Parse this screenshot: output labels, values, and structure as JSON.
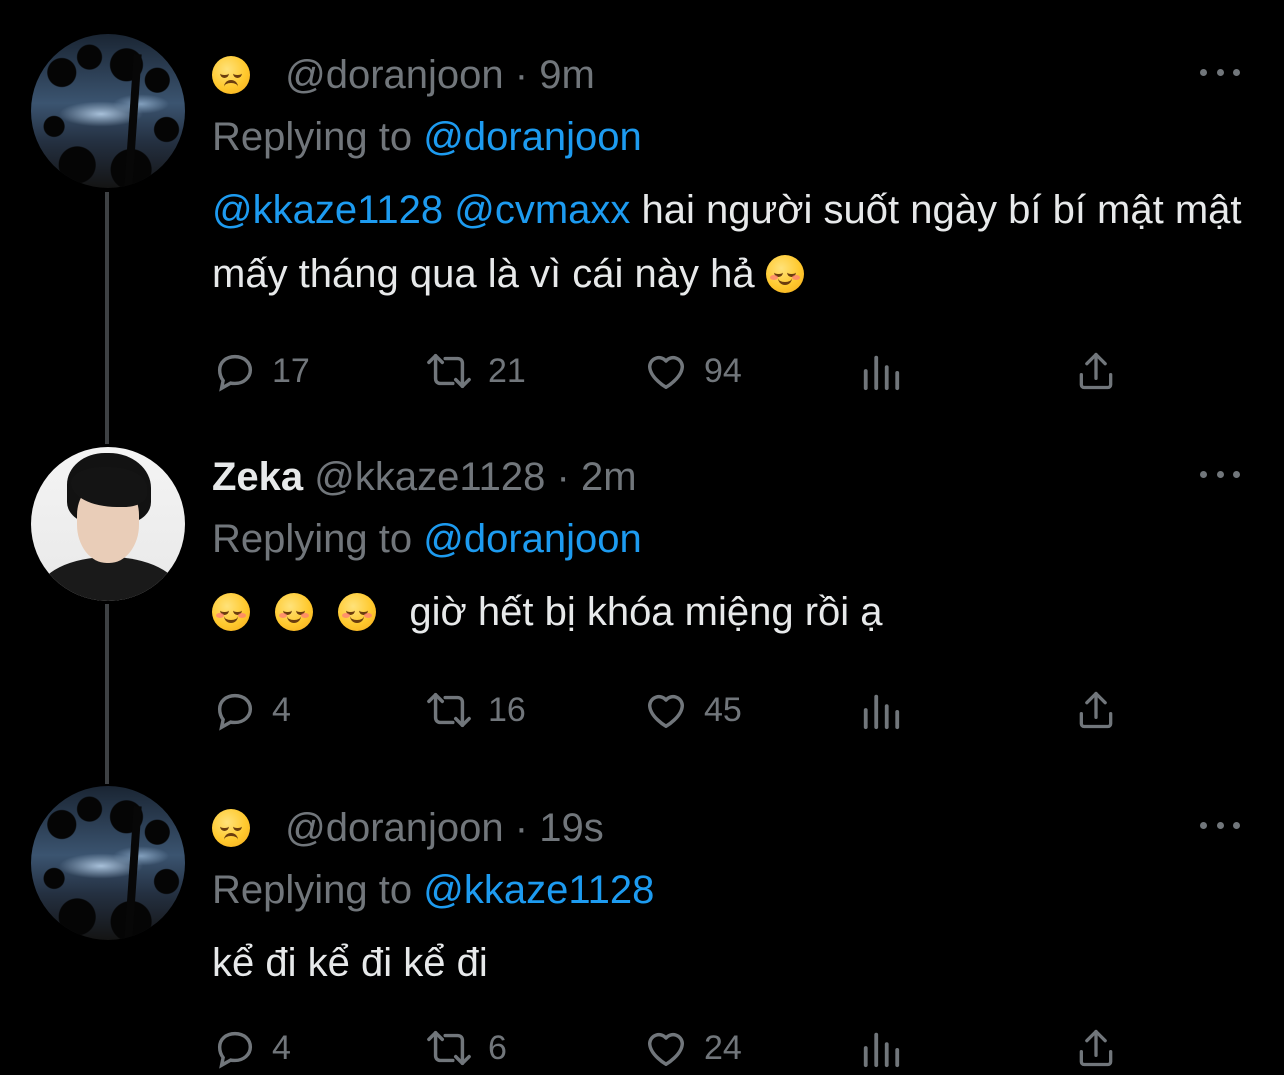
{
  "tweets": [
    {
      "display_name": "",
      "name_emoji": "pensive-face",
      "handle": "@doranjoon",
      "separator": "·",
      "time": "9m",
      "replying_prefix": "Replying to",
      "replying_to": "@doranjoon",
      "text_mention_1": "@kkaze1128",
      "text_mention_2": "@cvmaxx",
      "text": "hai người suốt ngày bí bí mật mật mấy tháng qua là vì cái này hả",
      "text_emoji": "smiling-face",
      "replies": "17",
      "retweets": "21",
      "likes": "94"
    },
    {
      "display_name": "Zeka",
      "handle": "@kkaze1128",
      "separator": "·",
      "time": "2m",
      "replying_prefix": "Replying to",
      "replying_to": "@doranjoon",
      "text_emojis": [
        "smiling-face-with-smiling-eyes",
        "smiling-face-with-smiling-eyes",
        "smiling-face-with-smiling-eyes"
      ],
      "text": "giờ hết bị khóa miệng rồi ạ",
      "replies": "4",
      "retweets": "16",
      "likes": "45"
    },
    {
      "display_name": "",
      "name_emoji": "pensive-face",
      "handle": "@doranjoon",
      "separator": "·",
      "time": "19s",
      "replying_prefix": "Replying to",
      "replying_to": "@kkaze1128",
      "text": "kể đi kể đi kể đi",
      "replies": "4",
      "retweets": "6",
      "likes": "24"
    }
  ],
  "colors": {
    "background": "#000000",
    "text_primary": "#e7e9ea",
    "text_secondary": "#71767b",
    "link": "#1d9bf0",
    "thread_line": "#3e4144"
  }
}
